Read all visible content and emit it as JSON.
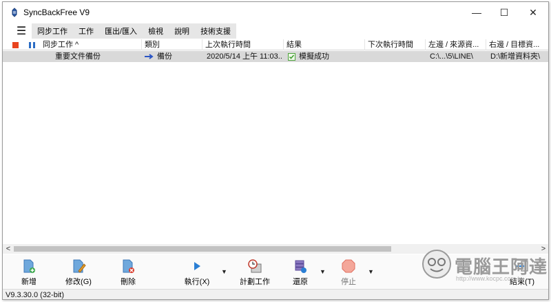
{
  "window": {
    "title": "SyncBackFree V9"
  },
  "title_buttons": {
    "minimize": "—",
    "maximize": "☐",
    "close": "✕"
  },
  "menu": {
    "hamburger": "☰",
    "items": [
      "同步工作",
      "工作",
      "匯出/匯入",
      "檢視",
      "說明",
      "技術支援"
    ]
  },
  "columns": [
    "同步工作 ^",
    "類別",
    "上次執行時間",
    "結果",
    "下次執行時間",
    "左邊 / 來源資...",
    "右邊 / 目標資..."
  ],
  "rows": [
    {
      "name": "重要文件備份",
      "type": "備份",
      "last_run": "2020/5/14 上午 11:03...",
      "result": "模擬成功",
      "next_run": "",
      "source": "C:\\...\\5\\LINE\\",
      "target": "D:\\新增資料夾\\"
    }
  ],
  "scroll": {
    "left": "<",
    "right": ">"
  },
  "toolbar": {
    "new": "新增",
    "modify": "修改(G)",
    "delete": "刪除",
    "run": "執行(X)",
    "schedule": "計劃工作",
    "restore": "還原",
    "stop": "停止",
    "exit": "結束(T)",
    "dropdown": "▼"
  },
  "status": {
    "version": "V9.3.30.0 (32-bit)"
  },
  "watermark": {
    "text": "電腦王阿達",
    "url": "http://www.kocpc.com.tw"
  },
  "colors": {
    "stop_square": "#e8431e",
    "pause_bars": "#2b6cc4",
    "row_highlight": "#d9d9d9",
    "menu_bg": "#e6e6e6"
  }
}
